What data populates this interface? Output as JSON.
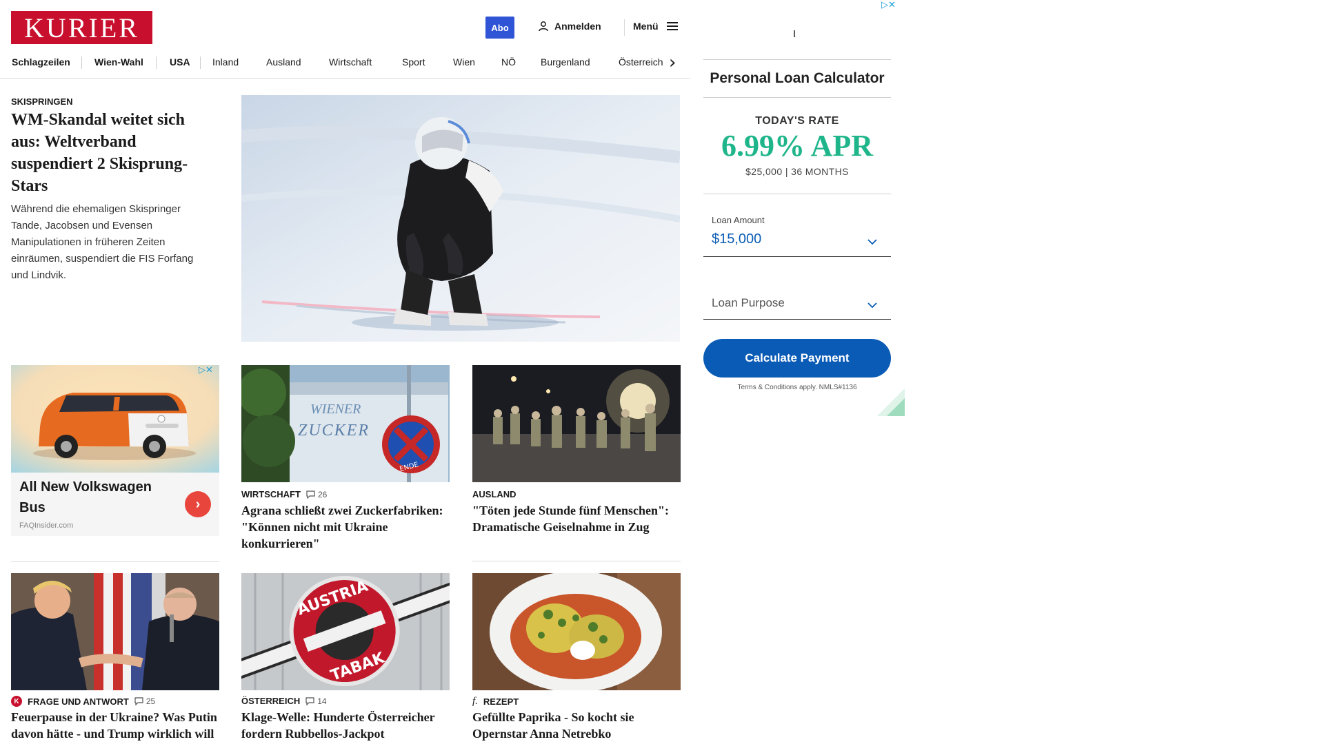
{
  "header": {
    "logo": "KURIER",
    "abo_label": "Abo",
    "login_label": "Anmelden",
    "menu_label": "Menü"
  },
  "nav": {
    "items": [
      "Schlagzeilen",
      "Wien-Wahl",
      "USA",
      "Inland",
      "Ausland",
      "Wirtschaft",
      "Sport",
      "Wien",
      "NÖ",
      "Burgenland",
      "Österreich"
    ]
  },
  "lead": {
    "kicker": "SKISPRINGEN",
    "title": "WM-Skandal weitet sich aus: Weltverband suspendiert 2 Skisprung-Stars",
    "text": "Während die ehemaligen Skispringer Tande, Jacobsen und Evensen Manipulationen in früheren Zeiten einräumen, suspendiert die FIS Forfang und Lindvik."
  },
  "native_ad": {
    "title": "All New Volkswagen Bus",
    "source": "FAQInsider.com"
  },
  "articles": [
    {
      "kicker": "WIRTSCHAFT",
      "comments": "26",
      "title": "Agrana schließt zwei Zuckerfabriken: \"Können nicht mit Ukraine konkurrieren\""
    },
    {
      "kicker": "AUSLAND",
      "comments": "",
      "title": "\"Töten jede Stunde fünf Menschen\": Dramatische Geiselnahme in Zug"
    },
    {
      "kicker": "FRAGE UND ANTWORT",
      "comments": "25",
      "title": "Feuerpause in der Ukraine? Was Putin davon hätte - und Trump wirklich will"
    },
    {
      "kicker": "ÖSTERREICH",
      "comments": "14",
      "title": "Klage-Welle: Hunderte Österreicher fordern Rubbellos-Jackpot"
    },
    {
      "kicker": "REZEPT",
      "comments": "",
      "title": "Gefüllte Paprika - So kocht sie Opernstar Anna Netrebko"
    }
  ],
  "image_text": {
    "zucker_sign_line1": "WIENER",
    "zucker_sign_line2": "ZUCKER",
    "zucker_road_sign": "ENDE",
    "tabak_sign_top": "AUSTRIA",
    "tabak_sign_bottom": "TABAK"
  },
  "loan_ad": {
    "title": "Personal Loan Calculator",
    "rate_label": "TODAY'S RATE",
    "rate_value": "6.99% APR",
    "rate_sub": "$25,000 | 36 MONTHS",
    "amount_label": "Loan Amount",
    "amount_value": "$15,000",
    "purpose_placeholder": "Loan Purpose",
    "button_label": "Calculate Payment",
    "terms": "Terms & Conditions apply. NMLS#1136"
  },
  "colors": {
    "brand_red": "#c8102e",
    "abo_blue": "#2f54d6",
    "rate_green": "#1fb58a",
    "loan_blue": "#0a5bb5"
  }
}
